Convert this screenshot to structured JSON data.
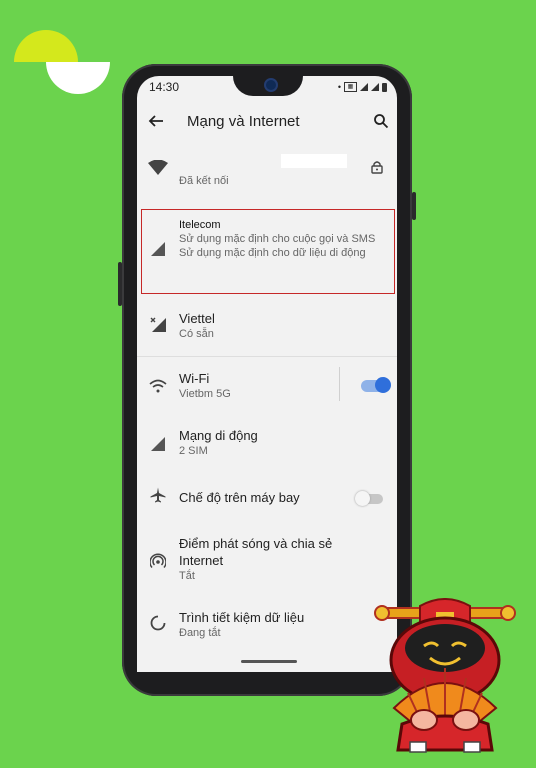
{
  "status_bar": {
    "time": "14:30"
  },
  "appbar": {
    "title": "Mạng và Internet"
  },
  "items": [
    {
      "name": "wifi-saved",
      "subtitle": "Đã kết nối"
    },
    {
      "name": "itelecom",
      "title": "Itelecom",
      "subtitle": "Sử dụng mặc định cho cuộc gọi và SMS\nSử dụng mặc định cho dữ liệu di động"
    },
    {
      "name": "viettel",
      "title": "Viettel",
      "subtitle": "Có sẵn"
    },
    {
      "name": "wifi",
      "title": "Wi-Fi",
      "subtitle": "Vietbm 5G",
      "toggle": true
    },
    {
      "name": "mobile-network",
      "title": "Mạng di động",
      "subtitle": "2 SIM"
    },
    {
      "name": "airplane",
      "title": "Chế độ trên máy bay",
      "toggle": false
    },
    {
      "name": "hotspot",
      "title": "Điểm phát sóng và chia sẻ Internet",
      "subtitle": "Tắt"
    },
    {
      "name": "data-saver",
      "title": "Trình tiết kiệm dữ liệu",
      "subtitle": "Đang tắt"
    }
  ],
  "colors": {
    "background": "#6bd34d",
    "accent": "#2f6fdb",
    "highlight_border": "#c62828"
  }
}
